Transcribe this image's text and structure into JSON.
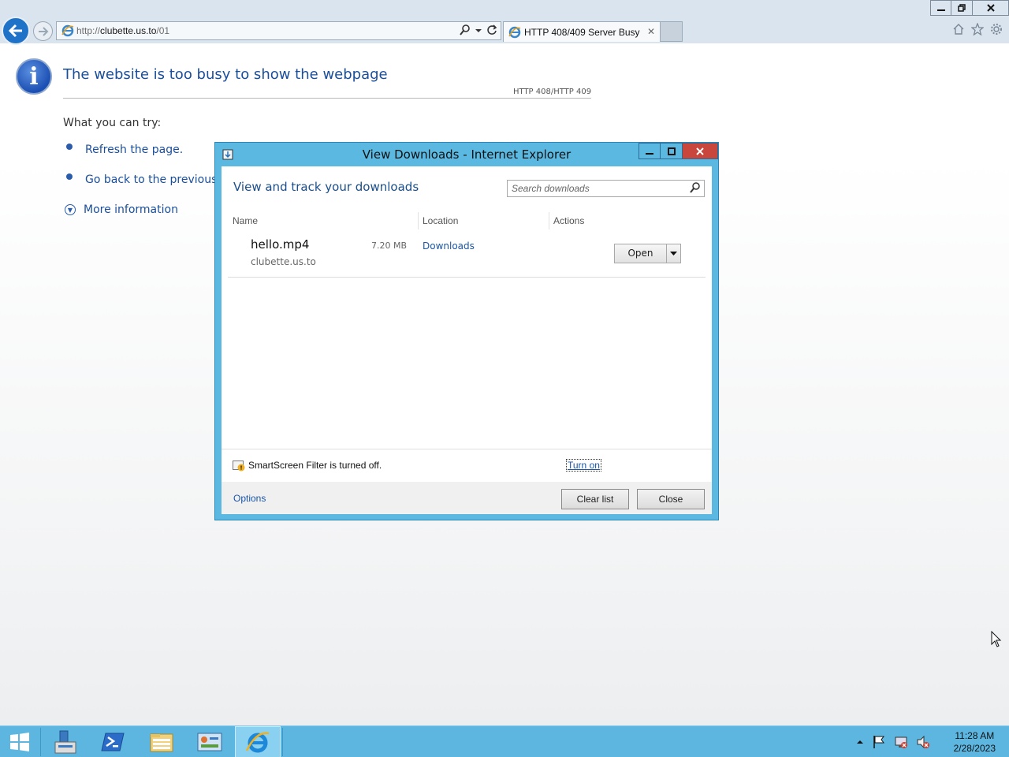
{
  "browser": {
    "address": {
      "url_prefix": "http://",
      "url_host": "clubette.us.to",
      "url_path": "/01"
    },
    "tab": {
      "title": "HTTP 408/409 Server Busy",
      "close": "✕"
    },
    "window_controls": {
      "minimize": "—",
      "restore": "❐",
      "close": "✕"
    }
  },
  "error_page": {
    "icon_letter": "i",
    "title": "The website is too busy to show the webpage",
    "code": "HTTP 408/HTTP 409",
    "try_label": "What you can try:",
    "suggestions": [
      "Refresh the page.",
      "Go back to the previous p",
      "More information"
    ]
  },
  "download_dialog": {
    "title": "View Downloads - Internet Explorer",
    "heading": "View and track your downloads",
    "search_placeholder": "Search downloads",
    "columns": {
      "name": "Name",
      "location": "Location",
      "actions": "Actions"
    },
    "items": [
      {
        "file_name": "hello.mp4",
        "size": "7.20 MB",
        "source": "clubette.us.to",
        "location": "Downloads",
        "action": "Open"
      }
    ],
    "smartscreen": {
      "text": "SmartScreen Filter is turned off.",
      "turn_on": "Turn on"
    },
    "footer": {
      "options": "Options",
      "clear_list": "Clear list",
      "close": "Close"
    }
  },
  "taskbar": {
    "time": "11:28 AM",
    "date": "2/28/2023"
  },
  "colors": {
    "accent": "#1e73c8",
    "dialog_frame": "#5bb8e0",
    "close_red": "#c9463d",
    "link": "#1a55a8",
    "taskbar": "#5cb6e0"
  }
}
